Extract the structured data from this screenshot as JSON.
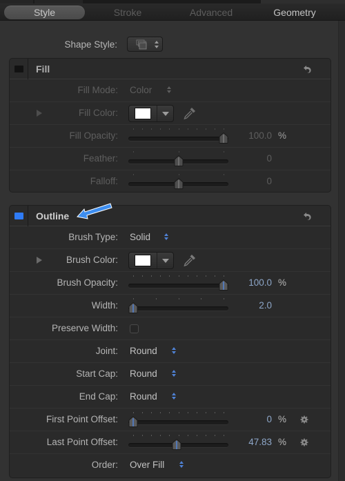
{
  "tabs": [
    {
      "label": "Style",
      "state": "active"
    },
    {
      "label": "Stroke",
      "state": "disabled"
    },
    {
      "label": "Advanced",
      "state": "disabled"
    },
    {
      "label": "Geometry",
      "state": "normal"
    }
  ],
  "shape_style": {
    "label": "Shape Style:",
    "icon": "shape-style-preset-icon"
  },
  "fill": {
    "title": "Fill",
    "enabled": false,
    "rows": {
      "fill_mode": {
        "label": "Fill Mode:",
        "value": "Color"
      },
      "fill_color": {
        "label": "Fill Color:",
        "color": "#ffffff"
      },
      "fill_opacity": {
        "label": "Fill Opacity:",
        "value": "100.0",
        "unit": "%",
        "fraction": 1.0
      },
      "feather": {
        "label": "Feather:",
        "value": "0",
        "fraction": 0.5
      },
      "falloff": {
        "label": "Falloff:",
        "value": "0",
        "fraction": 0.5
      }
    }
  },
  "outline": {
    "title": "Outline",
    "enabled": true,
    "accent_color": "#2f7bf5",
    "rows": {
      "brush_type": {
        "label": "Brush Type:",
        "value": "Solid"
      },
      "brush_color": {
        "label": "Brush Color:",
        "color": "#ffffff"
      },
      "brush_opacity": {
        "label": "Brush Opacity:",
        "value": "100.0",
        "unit": "%",
        "fraction": 1.0
      },
      "width": {
        "label": "Width:",
        "value": "2.0",
        "fraction": 0.0
      },
      "preserve_width": {
        "label": "Preserve Width:",
        "checked": false
      },
      "joint": {
        "label": "Joint:",
        "value": "Round"
      },
      "start_cap": {
        "label": "Start Cap:",
        "value": "Round"
      },
      "end_cap": {
        "label": "End Cap:",
        "value": "Round"
      },
      "first_point_offset": {
        "label": "First Point Offset:",
        "value": "0",
        "unit": "%",
        "fraction": 0.0
      },
      "last_point_offset": {
        "label": "Last Point Offset:",
        "value": "47.83",
        "unit": "%",
        "fraction": 0.4783
      },
      "order": {
        "label": "Order:",
        "value": "Over Fill"
      }
    }
  },
  "annotation": {
    "type": "arrow",
    "points_to": "outline-title",
    "color": "#3d8ef0"
  }
}
